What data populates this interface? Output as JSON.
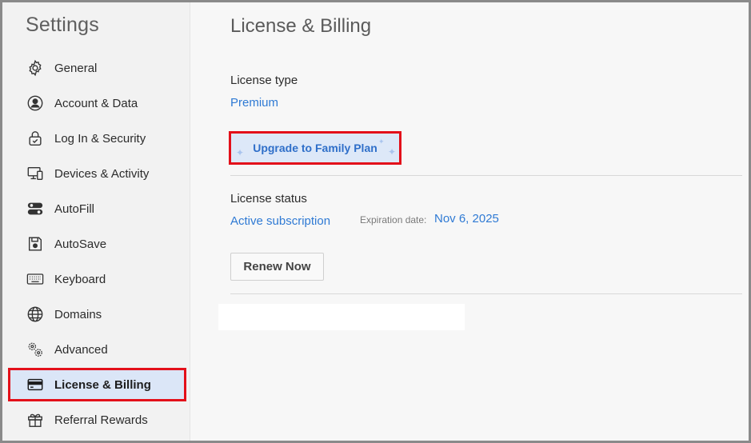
{
  "sidebar": {
    "title": "Settings",
    "items": [
      {
        "label": "General",
        "icon": "gear-icon"
      },
      {
        "label": "Account & Data",
        "icon": "user-circle-icon"
      },
      {
        "label": "Log In & Security",
        "icon": "lock-icon"
      },
      {
        "label": "Devices & Activity",
        "icon": "devices-icon"
      },
      {
        "label": "AutoFill",
        "icon": "autofill-toggle-icon"
      },
      {
        "label": "AutoSave",
        "icon": "save-icon"
      },
      {
        "label": "Keyboard",
        "icon": "keyboard-icon"
      },
      {
        "label": "Domains",
        "icon": "globe-icon"
      },
      {
        "label": "Advanced",
        "icon": "gears-icon"
      },
      {
        "label": "License & Billing",
        "icon": "credit-card-icon",
        "active": true
      },
      {
        "label": "Referral Rewards",
        "icon": "gift-icon"
      }
    ]
  },
  "main": {
    "title": "License & Billing",
    "license_type": {
      "label": "License type",
      "value": "Premium"
    },
    "upgrade_button": {
      "label": "Upgrade to Family Plan"
    },
    "license_status": {
      "label": "License status",
      "value": "Active subscription",
      "expiration_label": "Expiration date:",
      "expiration_value": "Nov 6, 2025"
    },
    "renew_button": {
      "label": "Renew Now"
    }
  },
  "colors": {
    "accent_link": "#2f7ad4",
    "active_nav_bg": "#dbe6f7",
    "highlight_border": "#e3101a"
  }
}
